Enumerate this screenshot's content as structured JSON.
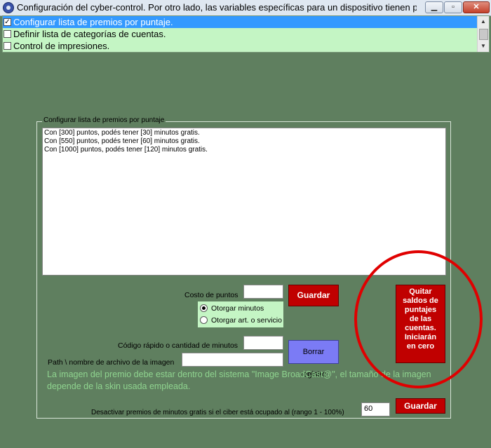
{
  "window": {
    "title": "Configuración del cyber-control. Por otro lado, las variables específicas para un dispositivo tienen priorida...",
    "minimize_icon": "minimize-icon",
    "maximize_icon": "maximize-icon",
    "close_icon": "close-icon"
  },
  "tasks": {
    "items": [
      {
        "label": "Configurar lista de premios por puntaje.",
        "checked": true,
        "selected": true
      },
      {
        "label": "Definir lista de categorías de cuentas.",
        "checked": false,
        "selected": false
      },
      {
        "label": "Control de impresiones.",
        "checked": false,
        "selected": false
      }
    ]
  },
  "group": {
    "title": "Configurar lista de premios por puntaje",
    "prize_lines": [
      "Con [300] puntos, podés tener [30] minutos gratis.",
      "Con [550] puntos, podés tener [60] minutos gratis.",
      "Con [1000] puntos, podés tener [120] minutos gratis."
    ]
  },
  "form": {
    "cost_label": "Costo de puntos",
    "cost_value": "",
    "save_label": "Guardar",
    "radio_minutes": "Otorgar minutos",
    "radio_service": "Otorgar art. o servicio",
    "quick_code_label": "Código rápido o cantidad de minutos",
    "quick_code_value": "",
    "image_path_label": "Path \\ nombre de archivo de la imagen",
    "image_path_value": "",
    "delete_label": "Borrar registro",
    "reset_lines": [
      "Quitar",
      "saldos de",
      "puntajes",
      "de las",
      "cuentas.",
      "Iniciarán",
      "en cero"
    ],
    "info_text": "La imagen del premio debe estar dentro del sistema \"Image BroadCast@\", el tamaño de la imagen depende de la skin usada empleada.",
    "deactivate_label": "Desactivar premios de minutos gratis si el ciber está ocupado al (rango 1 - 100%)",
    "deactivate_value": "60",
    "save2_label": "Guardar"
  },
  "colors": {
    "background": "#5f7f5f",
    "list_background": "#c4f5c4",
    "selection": "#3399ff",
    "button_red": "#c00000",
    "button_blue": "#7b7bf5",
    "info_text": "#8fd48f",
    "annotation": "#e00000"
  }
}
